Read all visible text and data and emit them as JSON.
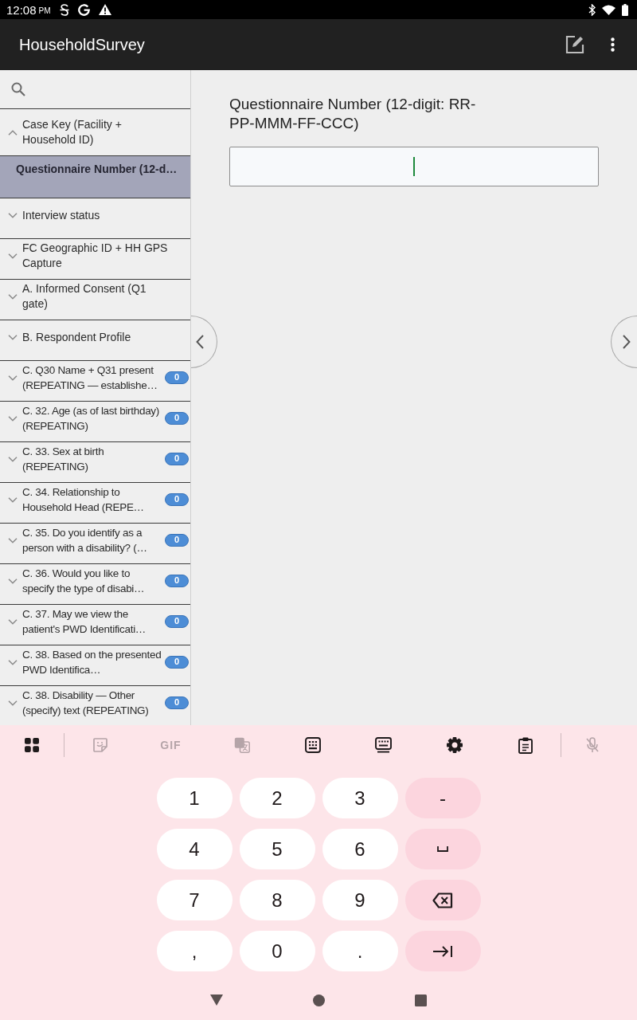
{
  "status_bar": {
    "time": "12:08",
    "meridiem": "PM"
  },
  "app_bar": {
    "title": "HouseholdSurvey"
  },
  "sidebar": {
    "items": [
      {
        "label": "Case Key (Facility + Household ID)",
        "expanded": true,
        "selected": false,
        "children": [
          {
            "label": "Questionnaire Number (12-d…",
            "selected": true
          }
        ]
      },
      {
        "label": "Interview status",
        "expanded": false,
        "selected": false
      },
      {
        "label": "FC Geographic ID + HH GPS Capture",
        "expanded": false,
        "selected": false
      },
      {
        "label": "A. Informed Consent (Q1 gate)",
        "expanded": false,
        "selected": false
      },
      {
        "label": "B. Respondent Profile",
        "expanded": false,
        "selected": false
      },
      {
        "label": "C. Q30 Name + Q31 present (REPEATING — establishe…",
        "expanded": false,
        "selected": false,
        "count": "0"
      },
      {
        "label": "C. 32. Age (as of last birthday) (REPEATING)",
        "expanded": false,
        "selected": false,
        "count": "0"
      },
      {
        "label": "C. 33. Sex at birth (REPEATING)",
        "expanded": false,
        "selected": false,
        "count": "0"
      },
      {
        "label": "C. 34. Relationship to Household Head (REPE…",
        "expanded": false,
        "selected": false,
        "count": "0"
      },
      {
        "label": "C. 35. Do you identify as a person with a disability? (…",
        "expanded": false,
        "selected": false,
        "count": "0"
      },
      {
        "label": "C. 36. Would you like to specify the type of disabi…",
        "expanded": false,
        "selected": false,
        "count": "0"
      },
      {
        "label": "C. 37. May we view the patient's PWD Identificati…",
        "expanded": false,
        "selected": false,
        "count": "0"
      },
      {
        "label": "C. 38. Based on the presented PWD Identifica…",
        "expanded": false,
        "selected": false,
        "count": "0"
      },
      {
        "label": "C. 38. Disability — Other (specify) text (REPEATING)",
        "expanded": false,
        "selected": false,
        "count": "0"
      }
    ]
  },
  "question": {
    "label": "Questionnaire Number (12-digit: RR-PP-MMM-FF-CCC)",
    "focused": true
  },
  "keyboard": {
    "toolbar": [
      {
        "kind": "apps",
        "disabled": false
      },
      {
        "kind": "sticker",
        "disabled": true
      },
      {
        "kind": "gif",
        "label": "GIF",
        "disabled": true
      },
      {
        "kind": "translate",
        "disabled": true
      },
      {
        "kind": "numpad",
        "disabled": false
      },
      {
        "kind": "keyboard",
        "disabled": false
      },
      {
        "kind": "settings",
        "disabled": false
      },
      {
        "kind": "clipboard",
        "disabled": false
      },
      {
        "kind": "voice",
        "disabled": true
      }
    ],
    "keys": [
      {
        "kind": "char",
        "label": "1"
      },
      {
        "kind": "char",
        "label": "2"
      },
      {
        "kind": "char",
        "label": "3"
      },
      {
        "kind": "action",
        "label": "-"
      },
      {
        "kind": "char",
        "label": "4"
      },
      {
        "kind": "char",
        "label": "5"
      },
      {
        "kind": "char",
        "label": "6"
      },
      {
        "kind": "space"
      },
      {
        "kind": "char",
        "label": "7"
      },
      {
        "kind": "char",
        "label": "8"
      },
      {
        "kind": "char",
        "label": "9"
      },
      {
        "kind": "backspace"
      },
      {
        "kind": "char",
        "label": ","
      },
      {
        "kind": "char",
        "label": "0"
      },
      {
        "kind": "char",
        "label": "."
      },
      {
        "kind": "tab"
      }
    ]
  }
}
